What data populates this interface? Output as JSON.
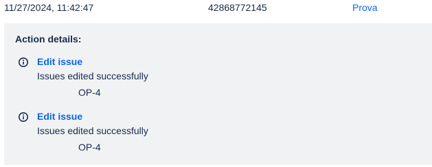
{
  "row": {
    "timestamp": "11/27/2024, 11:42:47",
    "id": "42868772145",
    "link": "Prova"
  },
  "details": {
    "title": "Action details:",
    "entries": [
      {
        "title": "Edit issue",
        "message": "Issues edited successfully",
        "issue_key": "OP-4",
        "icon": "info-icon"
      },
      {
        "title": "Edit issue",
        "message": "Issues edited successfully",
        "issue_key": "OP-4",
        "icon": "info-icon"
      }
    ]
  }
}
